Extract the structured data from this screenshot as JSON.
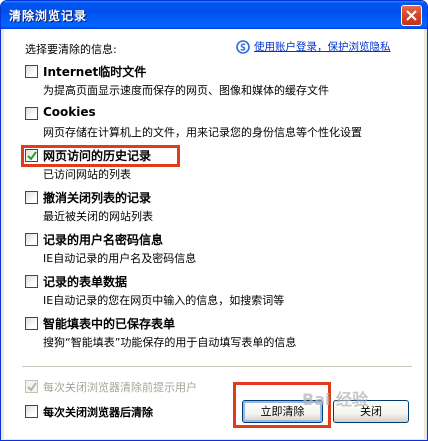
{
  "window": {
    "title": "清除浏览记录"
  },
  "prompt": "选择要清除的信息:",
  "privacy_link": "使用账户登录，保护浏览隐私",
  "options": [
    {
      "label": "Internet临时文件",
      "desc": "为提高页面显示速度而保存的网页、图像和媒体的缓存文件",
      "checked": false
    },
    {
      "label": "Cookies",
      "desc": "网页存储在计算机上的文件，用来记录您的身份信息等个性化设置",
      "checked": false
    },
    {
      "label": "网页访问的历史记录",
      "desc": "已访问网站的列表",
      "checked": true
    },
    {
      "label": "撤消关闭列表的记录",
      "desc": "最近被关闭的网站列表",
      "checked": false
    },
    {
      "label": "记录的用户名密码信息",
      "desc": "IE自动记录的用户名及密码信息",
      "checked": false
    },
    {
      "label": "记录的表单数据",
      "desc": "IE自动记录的您在网页中输入的信息，如搜索词等",
      "checked": false
    },
    {
      "label": "智能填表中的已保存表单",
      "desc": "搜狗“智能填表”功能保存的用于自动填写表单的信息",
      "checked": false
    }
  ],
  "bottom": {
    "auto_clear_disabled": "每次关闭浏览器清除前提示用户",
    "auto_clear": "每次关闭浏览器后清除",
    "clear_now": "立即清除",
    "close": "关闭"
  },
  "watermark": "Bai 经验",
  "colors": {
    "highlight": "#e33a1a",
    "titlebar": "#0053ee",
    "link": "#0033cc"
  }
}
